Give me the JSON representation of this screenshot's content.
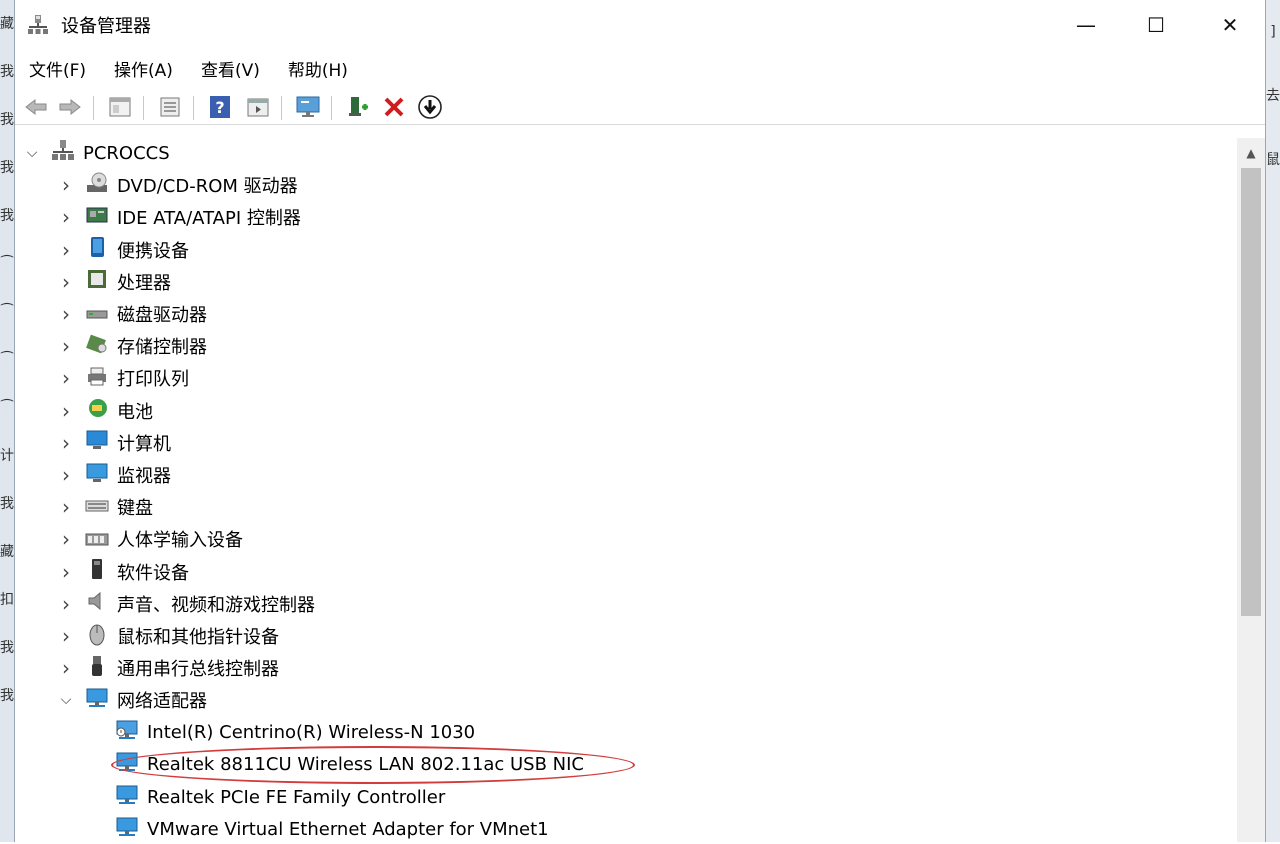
{
  "window": {
    "title": "设备管理器",
    "icon": "device-manager-icon",
    "controls": [
      "—",
      "☐",
      "✕"
    ]
  },
  "menu": [
    "文件(F)",
    "操作(A)",
    "查看(V)",
    "帮助(H)"
  ],
  "toolbar": [
    "back-arrow-icon",
    "forward-arrow-icon",
    "properties-icon",
    "print-icon",
    "help-icon",
    "view-icon",
    "monitor-icon",
    "add-driver-icon",
    "uninstall-icon",
    "update-icon"
  ],
  "tree": {
    "root": "PCROCCS",
    "categories": [
      {
        "label": "DVD/CD-ROM 驱动器",
        "icon": "dvd-drive-icon"
      },
      {
        "label": "IDE ATA/ATAPI 控制器",
        "icon": "ide-controller-icon"
      },
      {
        "label": "便携设备",
        "icon": "portable-device-icon"
      },
      {
        "label": "处理器",
        "icon": "processor-icon"
      },
      {
        "label": "磁盘驱动器",
        "icon": "disk-drive-icon"
      },
      {
        "label": "存储控制器",
        "icon": "storage-controller-icon"
      },
      {
        "label": "打印队列",
        "icon": "printer-icon"
      },
      {
        "label": "电池",
        "icon": "battery-icon"
      },
      {
        "label": "计算机",
        "icon": "computer-icon"
      },
      {
        "label": "监视器",
        "icon": "monitor-icon"
      },
      {
        "label": "键盘",
        "icon": "keyboard-icon"
      },
      {
        "label": "人体学输入设备",
        "icon": "hid-icon"
      },
      {
        "label": "软件设备",
        "icon": "software-device-icon"
      },
      {
        "label": "声音、视频和游戏控制器",
        "icon": "sound-icon"
      },
      {
        "label": "鼠标和其他指针设备",
        "icon": "mouse-icon"
      },
      {
        "label": "通用串行总线控制器",
        "icon": "usb-icon"
      },
      {
        "label": "网络适配器",
        "icon": "network-adapter-icon",
        "expanded": true
      }
    ],
    "network_children": [
      "Intel(R) Centrino(R) Wireless-N 1030",
      "Realtek 8811CU Wireless LAN 802.11ac USB NIC",
      "Realtek PCIe FE Family Controller",
      "VMware Virtual Ethernet Adapter for VMnet1"
    ]
  },
  "left_edge_chars": [
    "藏",
    "我",
    "我",
    "我",
    "我",
    "⁀",
    "⁀",
    "⁀",
    "⁀",
    "计",
    "我",
    "藏",
    "扣",
    "我",
    "我"
  ],
  "right_edge_chars": [
    "]",
    "去",
    "鼠"
  ],
  "colors": {
    "highlight": "#d23c3c"
  }
}
